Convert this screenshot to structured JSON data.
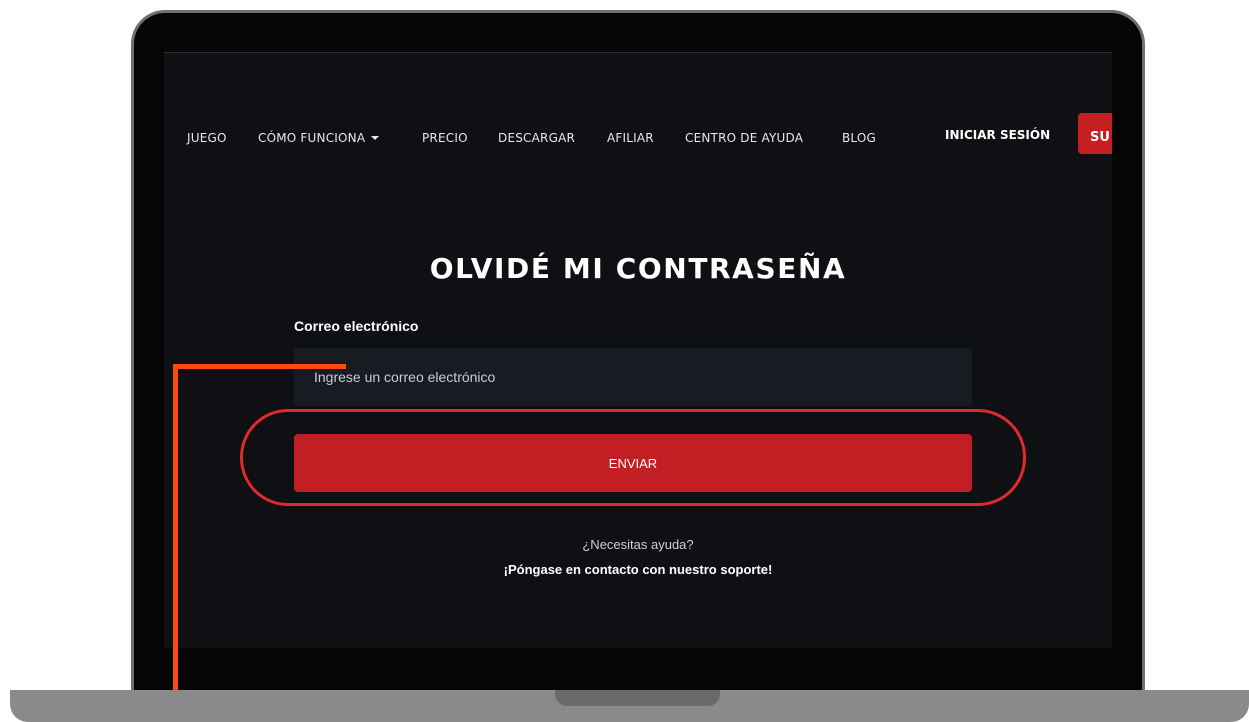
{
  "nav": {
    "items": [
      "JUEGO",
      "CÓMO FUNCIONA",
      "PRECIO",
      "DESCARGAR",
      "AFILIAR",
      "CENTRO DE AYUDA",
      "BLOG"
    ],
    "login_label": "INICIAR SESIÓN",
    "signup_label": "SU"
  },
  "page": {
    "title": "OLVIDÉ MI CONTRASEÑA",
    "email_label": "Correo electrónico",
    "email_placeholder": "Ingrese un correo electrónico",
    "submit_label": "ENVIAR",
    "help_question": "¿Necesitas ayuda?",
    "help_link": "¡Póngase en contacto con nuestro soporte!"
  },
  "colors": {
    "accent_red": "#c11f24",
    "highlight_ring": "#e02a2c",
    "callout_orange": "#ff4a0f",
    "background": "#0f1013"
  }
}
